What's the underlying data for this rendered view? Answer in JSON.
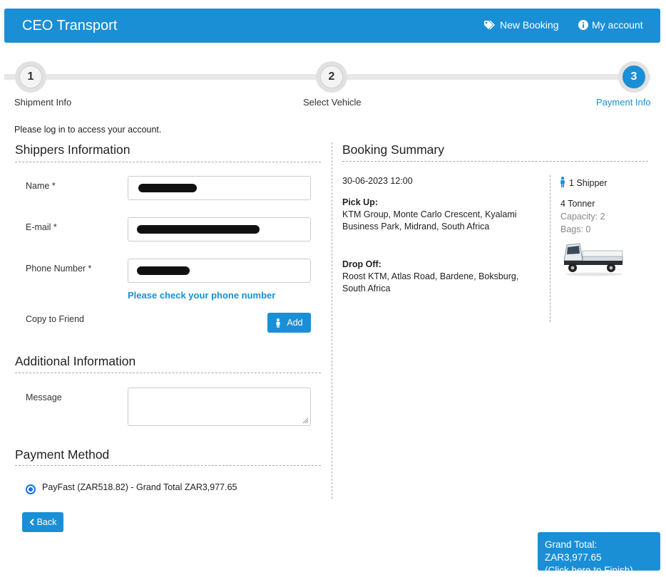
{
  "header": {
    "brand": "CEO Transport",
    "new_booking": "New Booking",
    "my_account": "My account"
  },
  "steps": [
    {
      "number": "1",
      "label": "Shipment Info"
    },
    {
      "number": "2",
      "label": "Select Vehicle"
    },
    {
      "number": "3",
      "label": "Payment Info"
    }
  ],
  "login_message": "Please log in to access your account.",
  "shippers": {
    "title": "Shippers Information",
    "name_label": "Name *",
    "email_label": "E-mail *",
    "phone_label": "Phone Number *",
    "phone_warning": "Please check your phone number",
    "copy_label": "Copy to Friend",
    "add_button": "Add"
  },
  "additional": {
    "title": "Additional Information",
    "message_label": "Message"
  },
  "payment": {
    "title": "Payment Method",
    "option_label": "PayFast (ZAR518.82) - Grand Total ZAR3,977.65"
  },
  "summary": {
    "title": "Booking Summary",
    "datetime": "30-06-2023 12:00",
    "pickup_heading": "Pick Up:",
    "pickup_line1": "KTM Group, Monte Carlo Crescent, Kyalami",
    "pickup_line2": "Business Park, Midrand, South Africa",
    "dropoff_heading": "Drop Off:",
    "dropoff_line1": "Roost KTM, Atlas Road, Bardene, Boksburg,",
    "dropoff_line2": "South Africa",
    "shipper_count": "1 Shipper",
    "vehicle": "4 Tonner",
    "capacity": "Capacity: 2",
    "bags": "Bags: 0"
  },
  "actions": {
    "back": "Back",
    "finish_line1": "Grand Total: ZAR3,977.65",
    "finish_line2": "(Click here to Finish)"
  },
  "colors": {
    "accent": "#1a8fd6",
    "radio": "#1a73e8"
  }
}
